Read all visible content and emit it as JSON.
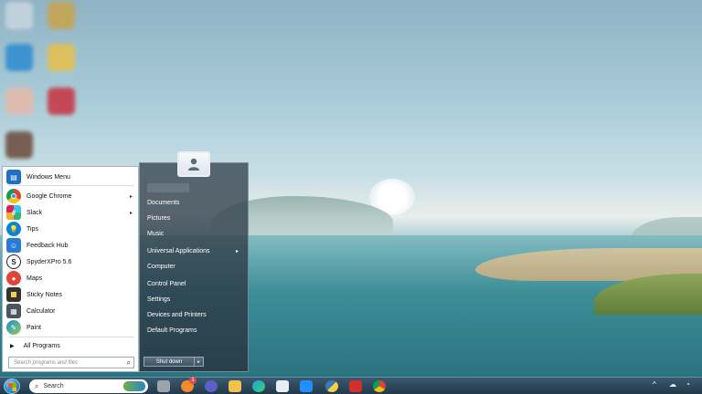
{
  "start_menu": {
    "pinned": [
      {
        "label": "Windows Menu",
        "icon": "windows-menu-icon",
        "color": "#1f6fc5"
      },
      {
        "label": "Google Chrome",
        "icon": "chrome-icon",
        "color": "#db4437",
        "arrow": "▸"
      },
      {
        "label": "Slack",
        "icon": "slack-icon",
        "color": "#4a154b",
        "arrow": "▸"
      },
      {
        "label": "Tips",
        "icon": "tips-icon",
        "color": "#0a84d6"
      },
      {
        "label": "Feedback Hub",
        "icon": "feedback-hub-icon",
        "color": "#2a7bd3"
      },
      {
        "label": "SpyderXPro 5.6",
        "icon": "spyder-icon",
        "color": "#222222",
        "glyph": "S"
      },
      {
        "label": "Maps",
        "icon": "maps-icon",
        "color": "#e0443a"
      },
      {
        "label": "Sticky Notes",
        "icon": "sticky-notes-icon",
        "color": "#333333"
      },
      {
        "label": "Calculator",
        "icon": "calculator-icon",
        "color": "#4a5560"
      },
      {
        "label": "Paint",
        "icon": "paint-icon",
        "color": "#1c8ad8"
      }
    ],
    "all_programs_label": "All Programs",
    "search_placeholder": "Search programs and files",
    "right_items": [
      {
        "label": "Documents"
      },
      {
        "label": "Pictures"
      },
      {
        "label": "Music"
      },
      {
        "label": "Universal Applications",
        "arrow": "▸"
      },
      {
        "label": "Computer"
      },
      {
        "label": "Control Panel"
      },
      {
        "label": "Settings"
      },
      {
        "label": "Devices and Printers"
      },
      {
        "label": "Default Programs"
      }
    ],
    "shutdown_label": "Shut down",
    "shutdown_options_glyph": "▸"
  },
  "taskbar": {
    "search_label": "Search",
    "apps": [
      {
        "name": "file-explorer-icon",
        "color": "#9aa4ad"
      },
      {
        "name": "notification-app-icon",
        "color": "#f28b30"
      },
      {
        "name": "teams-icon",
        "color": "#5b5fc7"
      },
      {
        "name": "folder-icon",
        "color": "#f2c14e"
      },
      {
        "name": "edge-icon",
        "color": "#1fa3d8"
      },
      {
        "name": "store-icon",
        "color": "#e9eef2"
      },
      {
        "name": "weather-app-icon",
        "color": "#1e90ff"
      },
      {
        "name": "python-icon",
        "color": "#3d7ab8"
      },
      {
        "name": "antivirus-icon",
        "color": "#d32f2f"
      },
      {
        "name": "chrome-taskbar-icon",
        "color": "#db4437"
      }
    ],
    "tray": {
      "chevron": "^",
      "badge": "1"
    }
  }
}
